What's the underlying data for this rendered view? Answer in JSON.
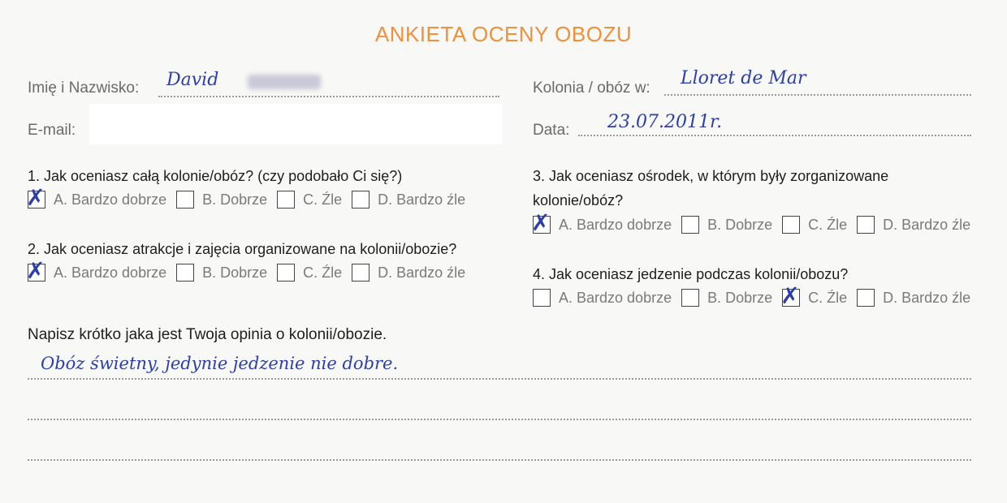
{
  "title": "ANKIETA OCENY OBOZU",
  "fields": {
    "name_label": "Imię i Nazwisko:",
    "name_value": "David",
    "email_label": "E-mail:",
    "camp_label": "Kolonia / obóz w:",
    "camp_value": "Lloret de Mar",
    "date_label": "Data:",
    "date_value": "23.07.2011r."
  },
  "questions": [
    {
      "text": "1. Jak oceniasz całą kolonie/obóz? (czy podobało Ci się?)",
      "options": [
        {
          "label": "A. Bardzo dobrze",
          "checked": true
        },
        {
          "label": "B. Dobrze",
          "checked": false
        },
        {
          "label": "C. Źle",
          "checked": false
        },
        {
          "label": "D. Bardzo źle",
          "checked": false
        }
      ]
    },
    {
      "text": "2.  Jak oceniasz atrakcje i zajęcia organizowane na kolonii/obozie?",
      "options": [
        {
          "label": "A. Bardzo dobrze",
          "checked": true
        },
        {
          "label": "B. Dobrze",
          "checked": false
        },
        {
          "label": "C. Źle",
          "checked": false
        },
        {
          "label": "D. Bardzo źle",
          "checked": false
        }
      ]
    },
    {
      "text_line1": "3. Jak oceniasz ośrodek, w którym były zorganizowane",
      "text_line2": "kolonie/obóz?",
      "options": [
        {
          "label": "A. Bardzo dobrze",
          "checked": true
        },
        {
          "label": "B. Dobrze",
          "checked": false
        },
        {
          "label": "C. Źle",
          "checked": false
        },
        {
          "label": "D. Bardzo źle",
          "checked": false
        }
      ]
    },
    {
      "text": "4.  Jak oceniasz jedzenie podczas kolonii/obozu?",
      "options": [
        {
          "label": "A. Bardzo dobrze",
          "checked": false
        },
        {
          "label": "B. Dobrze",
          "checked": false
        },
        {
          "label": "C. Źle",
          "checked": true
        },
        {
          "label": "D. Bardzo źle",
          "checked": false
        }
      ]
    }
  ],
  "opinion": {
    "prompt": "Napisz krótko jaka jest Twoja opinia o kolonii/obozie.",
    "answer": "Obóz świetny, jedynie jedzenie nie dobre."
  },
  "colors": {
    "accent": "#f0903a",
    "ink": "#2c3fa8"
  }
}
